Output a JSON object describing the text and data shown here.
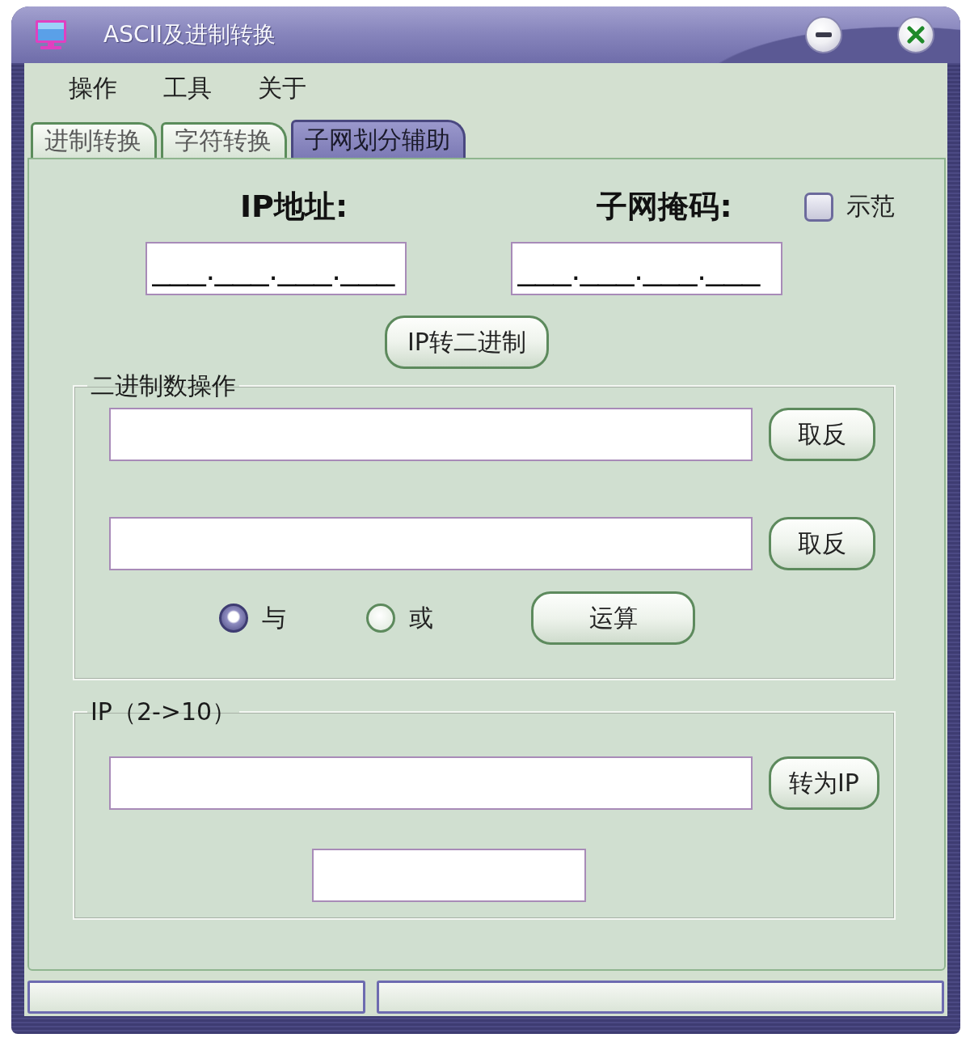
{
  "window": {
    "title": "ASCII及进制转换"
  },
  "menu": [
    {
      "label": "操作"
    },
    {
      "label": "工具"
    },
    {
      "label": "关于"
    }
  ],
  "tabs": [
    {
      "label": "进制转换",
      "selected": false
    },
    {
      "label": "字符转换",
      "selected": false
    },
    {
      "label": "子网划分辅助",
      "selected": true
    }
  ],
  "address_fields": [
    {
      "label": "IP地址:",
      "value": "___.___.___.___"
    },
    {
      "label": "子网掩码:",
      "value": "___.___.___.___"
    }
  ],
  "demo_checkbox": {
    "label": "示范",
    "checked": false
  },
  "ip_to_binary_button": "IP转二进制",
  "binary_group": {
    "title": "二进制数操作",
    "rows": [
      {
        "button": "取反"
      },
      {
        "button": "取反"
      }
    ],
    "operations": [
      {
        "label": "与",
        "selected": true
      },
      {
        "label": "或",
        "selected": false
      }
    ],
    "run_button": "运算"
  },
  "ip_group": {
    "title": "IP（2->10）",
    "convert_button": "转为IP"
  }
}
